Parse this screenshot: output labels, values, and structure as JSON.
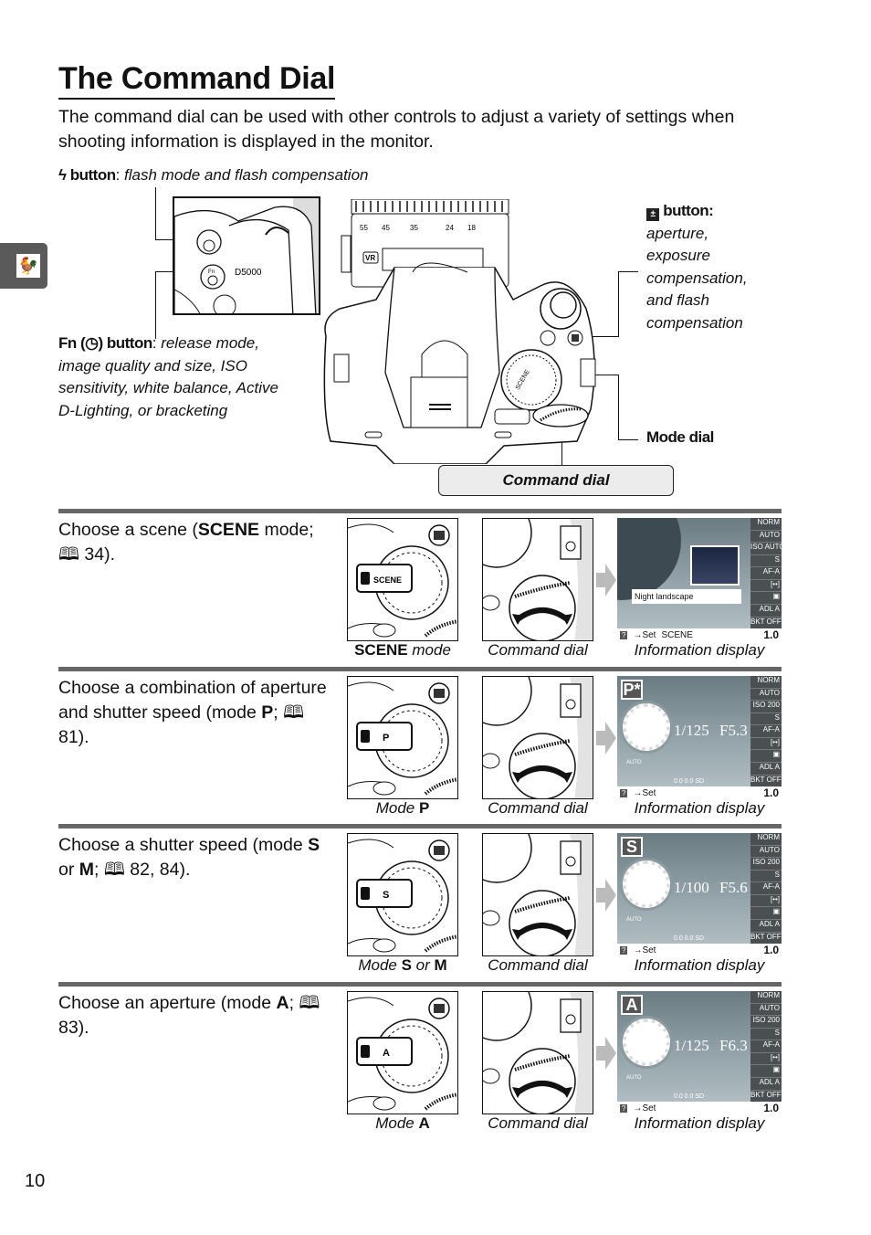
{
  "page": {
    "title": "The Command Dial",
    "intro": "The command dial can be used with other controls to adjust a variety of settings when shooting information is displayed in the monitor.",
    "page_number": "10",
    "section_tab_icon": "rooster-weathervane-icon"
  },
  "callouts": {
    "flash": {
      "label": "button",
      "separator": ":",
      "text": " flash mode and flash compensation",
      "icon": "flash-icon"
    },
    "fn": {
      "label": "Fn (◷) button",
      "separator": ":",
      "text": " release mode, image quality and size, ISO sensitivity, white balance, Active D-Lighting, or bracketing"
    },
    "ae": {
      "label": "button",
      "separator": ":",
      "text": "aperture, exposure compensation, and flash compensation",
      "icon": "exposure-compensation-icon"
    },
    "mode_dial": {
      "label": "Mode dial"
    },
    "command_dial": {
      "label": "Command dial"
    }
  },
  "camera": {
    "lens_scale": [
      "55",
      "45",
      "35",
      "24",
      "18"
    ],
    "vr_label": "VR",
    "model": "D5000"
  },
  "rows": [
    {
      "desc_pre": "Choose a scene (",
      "desc_bold": "SCENE",
      "desc_post": " mode;",
      "desc_ref": "🕮 34).",
      "dial_caption_bold": "SCENE",
      "dial_caption_italic": " mode",
      "dial_selected": "SCENE",
      "cmd_caption": "Command dial",
      "info_caption": "Information display",
      "info": {
        "type": "scene",
        "scene_name": "Night landscape",
        "bottom_left": "→Set",
        "bottom_mid": "SCENE",
        "count": "1.0",
        "side": [
          "NORM",
          "AUTO",
          "ISO AUTO",
          "S",
          "AF-A",
          "[••]",
          "▣",
          "ADL A",
          "BKT OFF"
        ]
      }
    },
    {
      "desc_pre": "Choose a combination of aperture and shutter speed (mode ",
      "desc_bold": "P",
      "desc_post": ";",
      "desc_ref": " 🕮 81).",
      "dial_caption_italic": "Mode ",
      "dial_caption_bold": "P",
      "dial_selected": "P",
      "cmd_caption": "Command dial",
      "info_caption": "Information display",
      "info": {
        "type": "exposure",
        "mode_badge": "P*",
        "shutter": "1/125",
        "aperture": "F5.3",
        "auto_label": "AUTO",
        "status": "0.0  0.0  SD",
        "bottom_left": "→Set",
        "count": "1.0",
        "side": [
          "NORM",
          "AUTO",
          "ISO 200",
          "S",
          "AF-A",
          "[••]",
          "▣",
          "ADL A",
          "BKT OFF"
        ]
      }
    },
    {
      "desc_pre": "Choose a shutter speed (mode ",
      "desc_bold": "S",
      "desc_mid": " or ",
      "desc_bold2": "M",
      "desc_post": ";",
      "desc_ref": " 🕮 82, 84).",
      "dial_caption_italic": "Mode ",
      "dial_caption_bold": "S",
      "dial_caption_mid": " or ",
      "dial_caption_bold2": "M",
      "dial_selected": "S",
      "cmd_caption": "Command dial",
      "info_caption": "Information display",
      "info": {
        "type": "exposure",
        "mode_badge": "S",
        "shutter": "1/100",
        "aperture": "F5.6",
        "auto_label": "AUTO",
        "status": "0.0  0.0  SD",
        "bottom_left": "→Set",
        "count": "1.0",
        "side": [
          "NORM",
          "AUTO",
          "ISO 200",
          "S",
          "AF-A",
          "[••]",
          "▣",
          "ADL A",
          "BKT OFF"
        ]
      }
    },
    {
      "desc_pre": "Choose an aperture (mode ",
      "desc_bold": "A",
      "desc_post": ";",
      "desc_ref": " 🕮 83).",
      "dial_caption_italic": "Mode ",
      "dial_caption_bold": "A",
      "dial_selected": "A",
      "cmd_caption": "Command dial",
      "info_caption": "Information display",
      "info": {
        "type": "exposure",
        "mode_badge": "A",
        "shutter": "1/125",
        "aperture": "F6.3",
        "auto_label": "AUTO",
        "status": "0.0  0.0  SD",
        "bottom_left": "→Set",
        "count": "1.0",
        "side": [
          "NORM",
          "AUTO",
          "ISO 200",
          "S",
          "AF-A",
          "[••]",
          "▣",
          "ADL A",
          "BKT OFF"
        ]
      }
    }
  ]
}
